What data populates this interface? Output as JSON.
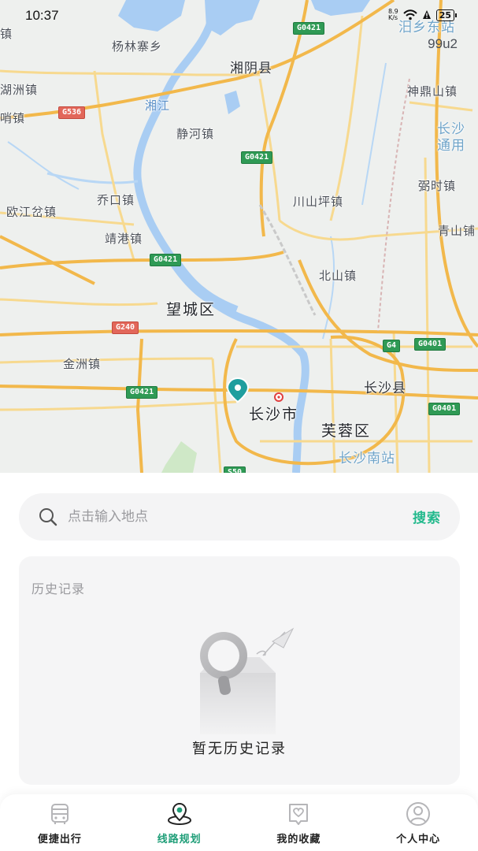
{
  "status_bar": {
    "time": "10:37",
    "net_speed_top": "8.9",
    "net_speed_unit": "K/s",
    "battery": "25",
    "icons": [
      "wifi-icon",
      "alert-icon",
      "battery-icon"
    ]
  },
  "map": {
    "version_label": "99u2",
    "places": {
      "yanglin": "杨林寨乡",
      "xiangyin": "湘阴县",
      "hongzhou_edge": "湖洲镇",
      "shao_edge": "哨镇",
      "xiangjiang": "湘江",
      "jinghe": "静河镇",
      "shendingshan": "神鼎山镇",
      "changsha_tong": "长沙 通用",
      "qiaokou": "乔口镇",
      "chuanshanping": "川山坪镇",
      "ouijiang": "欧江岔镇",
      "jinggang": "靖港镇",
      "qiaoshi": "弼时镇",
      "qingshan": "青山铺",
      "beishan": "北山镇",
      "wangcheng": "望城区",
      "jinzhou": "金洲镇",
      "changsha_county": "长沙县",
      "changsha_city": "长沙市",
      "furong": "芙蓉区",
      "changsha_south": "长沙南站",
      "yuexiang_east": "汨乡东站",
      "top_left_edge": "镇"
    },
    "shields": {
      "g0421_top": "G0421",
      "g0421_mid": "G0421",
      "g0421_left": "G0421",
      "g0421_low": "G0421",
      "g0401_right": "G0401",
      "g0401_low": "G0401",
      "g536": "G536",
      "g240": "G240",
      "g4": "G4",
      "s50": "S50"
    }
  },
  "search": {
    "placeholder": "点击输入地点",
    "button_label": "搜索"
  },
  "history": {
    "title": "历史记录",
    "empty_text": "暂无历史记录"
  },
  "nav": {
    "items": [
      {
        "label": "便捷出行",
        "icon": "bus-icon",
        "active": false
      },
      {
        "label": "线路规划",
        "icon": "route-location-icon",
        "active": true
      },
      {
        "label": "我的收藏",
        "icon": "favorite-icon",
        "active": false
      },
      {
        "label": "个人中心",
        "icon": "user-icon",
        "active": false
      }
    ]
  },
  "colors": {
    "accent": "#22b98c",
    "active_nav": "#1f9e78",
    "road_major": "#f2b84b",
    "road_minor": "#f7d78a",
    "water": "#a9cdf3"
  }
}
